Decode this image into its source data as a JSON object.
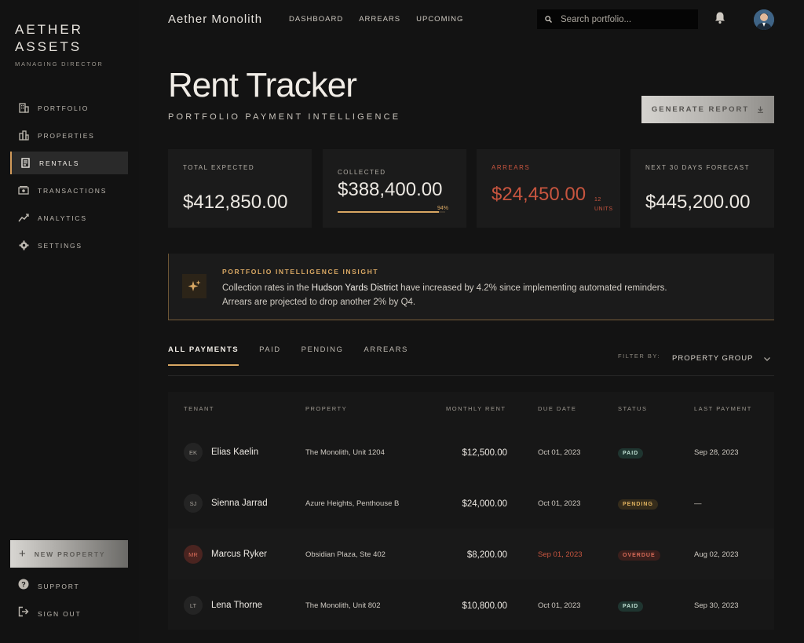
{
  "brand": {
    "line1": "AETHER",
    "line2": "ASSETS",
    "role": "MANAGING DIRECTOR"
  },
  "sidebar": {
    "items": [
      {
        "label": "PORTFOLIO",
        "icon": "building-icon",
        "active": false
      },
      {
        "label": "PROPERTIES",
        "icon": "city-icon",
        "active": false
      },
      {
        "label": "RENTALS",
        "icon": "receipt-icon",
        "active": true
      },
      {
        "label": "TRANSACTIONS",
        "icon": "cash-icon",
        "active": false
      },
      {
        "label": "ANALYTICS",
        "icon": "trend-icon",
        "active": false
      },
      {
        "label": "SETTINGS",
        "icon": "gear-icon",
        "active": false
      }
    ],
    "new_property": "NEW PROPERTY",
    "support": "SUPPORT",
    "sign_out": "SIGN OUT"
  },
  "topbar": {
    "app_title": "Aether Monolith",
    "nav": [
      "DASHBOARD",
      "ARREARS",
      "UPCOMING"
    ],
    "search_placeholder": "Search portfolio..."
  },
  "header": {
    "title": "Rent Tracker",
    "subtitle": "PORTFOLIO PAYMENT INTELLIGENCE",
    "generate_report": "GENERATE REPORT"
  },
  "stats": {
    "total_expected": {
      "label": "TOTAL EXPECTED",
      "value": "$412,850.00"
    },
    "collected": {
      "label": "COLLECTED",
      "value": "$388,400.00",
      "percent_label": "94%",
      "percent": 94
    },
    "arrears": {
      "label": "ARREARS",
      "value": "$24,450.00",
      "units_count": "12",
      "units_label": "UNITS"
    },
    "forecast": {
      "label": "NEXT 30 DAYS FORECAST",
      "value": "$445,200.00"
    }
  },
  "insight": {
    "title": "PORTFOLIO INTELLIGENCE INSIGHT",
    "text_before": "Collection rates in the ",
    "highlight": "Hudson Yards District",
    "text_after": " have increased by 4.2% since implementing automated reminders.",
    "line2": "Arrears are projected to drop another 2% by Q4."
  },
  "tabs": [
    "ALL PAYMENTS",
    "PAID",
    "PENDING",
    "ARREARS"
  ],
  "filter": {
    "label": "FILTER BY:",
    "value": "PROPERTY GROUP"
  },
  "table": {
    "headers": [
      "TENANT",
      "PROPERTY",
      "MONTHLY RENT",
      "DUE DATE",
      "STATUS",
      "LAST PAYMENT"
    ],
    "rows": [
      {
        "initials": "EK",
        "tenant": "Elias Kaelin",
        "property": "The Monolith, Unit 1204",
        "rent": "$12,500.00",
        "due": "Oct 01, 2023",
        "status": "PAID",
        "last": "Sep 28, 2023"
      },
      {
        "initials": "SJ",
        "tenant": "Sienna Jarrad",
        "property": "Azure Heights, Penthouse B",
        "rent": "$24,000.00",
        "due": "Oct 01, 2023",
        "status": "PENDING",
        "last": "—"
      },
      {
        "initials": "MR",
        "tenant": "Marcus Ryker",
        "property": "Obsidian Plaza, Ste 402",
        "rent": "$8,200.00",
        "due": "Sep 01, 2023",
        "status": "OVERDUE",
        "last": "Aug 02, 2023"
      },
      {
        "initials": "LT",
        "tenant": "Lena Thorne",
        "property": "The Monolith, Unit 802",
        "rent": "$10,800.00",
        "due": "Oct 01, 2023",
        "status": "PAID",
        "last": "Sep 30, 2023"
      }
    ]
  },
  "colors": {
    "accent": "#d8a763",
    "danger": "#c8553f",
    "paid": "#bfe0d3",
    "background": "#131313"
  }
}
